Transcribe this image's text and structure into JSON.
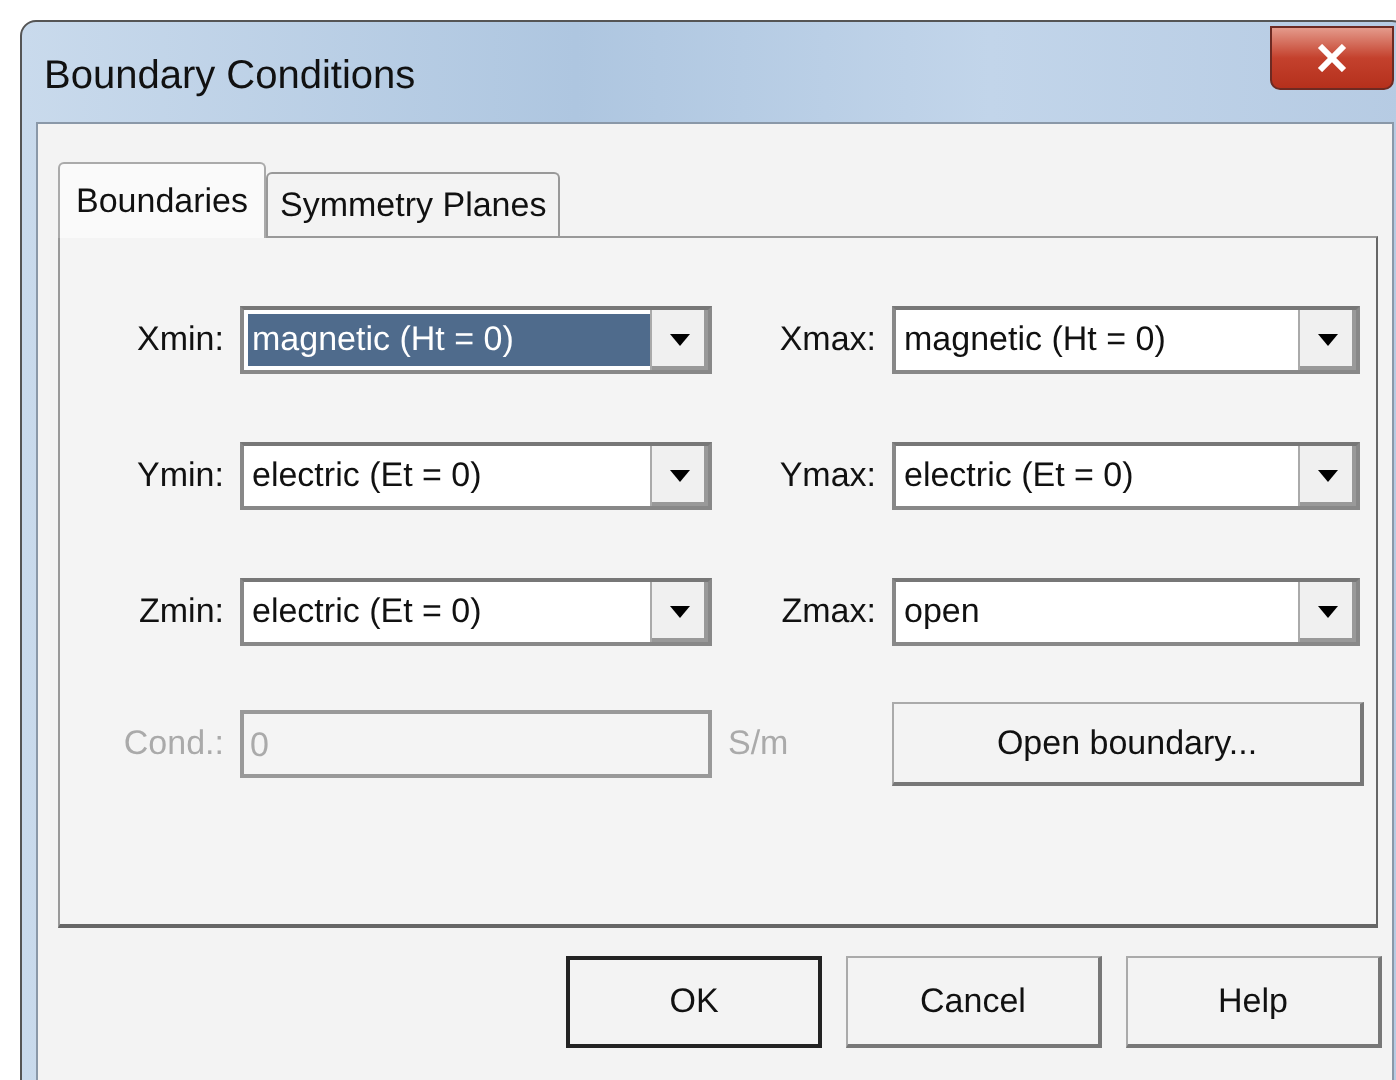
{
  "window": {
    "title": "Boundary Conditions"
  },
  "tabs": [
    {
      "label": "Boundaries",
      "selected": true
    },
    {
      "label": "Symmetry Planes",
      "selected": false
    }
  ],
  "fields": [
    {
      "label": "Xmin:",
      "value": "magnetic (Ht = 0)",
      "selected": true
    },
    {
      "label": "Xmax:",
      "value": "magnetic (Ht = 0)",
      "selected": false
    },
    {
      "label": "Ymin:",
      "value": "electric (Et = 0)",
      "selected": false
    },
    {
      "label": "Ymax:",
      "value": "electric (Et = 0)",
      "selected": false
    },
    {
      "label": "Zmin:",
      "value": "electric (Et = 0)",
      "selected": false
    },
    {
      "label": "Zmax:",
      "value": "open",
      "selected": false
    }
  ],
  "conductivity": {
    "label": "Cond.:",
    "value": "0",
    "unit": "S/m",
    "disabled": true
  },
  "open_boundary_button": "Open boundary...",
  "buttons": [
    {
      "label": "OK",
      "default": true
    },
    {
      "label": "Cancel",
      "default": false
    },
    {
      "label": "Help",
      "default": false
    }
  ]
}
